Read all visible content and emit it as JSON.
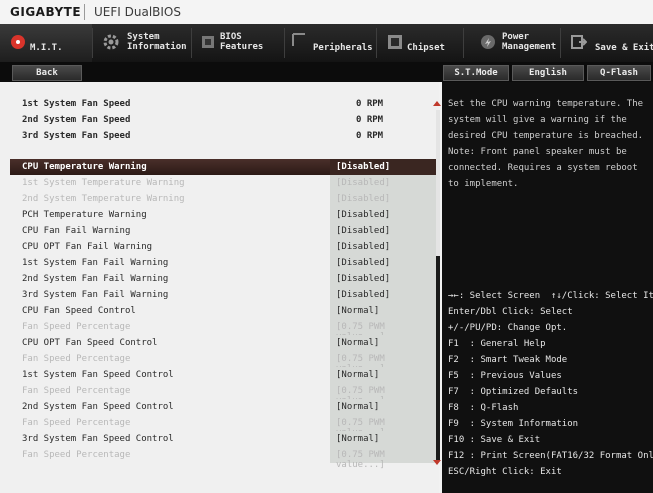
{
  "brand": {
    "logo_text": "GIGABYTE",
    "bios_name": "UEFI DualBIOS"
  },
  "tabs": [
    {
      "label": "M.I.T.",
      "icon": "mit-icon",
      "active": true
    },
    {
      "label": "System\nInformation",
      "icon": "gear-icon"
    },
    {
      "label": "BIOS\nFeatures",
      "icon": "bios-icon"
    },
    {
      "label": "Peripherals",
      "icon": "peripherals-icon"
    },
    {
      "label": "Chipset",
      "icon": "chipset-icon"
    },
    {
      "label": "Power\nManagement",
      "icon": "power-icon"
    },
    {
      "label": "Save & Exit",
      "icon": "exit-icon"
    }
  ],
  "subbar": {
    "back": "Back",
    "st_mode": "S.T.Mode",
    "language": "English",
    "qflash": "Q-Flash"
  },
  "fan_speeds": [
    {
      "label": "1st System Fan Speed",
      "value": "0 RPM"
    },
    {
      "label": "2nd System Fan Speed",
      "value": "0 RPM"
    },
    {
      "label": "3rd System Fan Speed",
      "value": "0 RPM"
    }
  ],
  "settings": [
    {
      "label": "CPU Temperature Warning",
      "value": "[Disabled]",
      "state": "sel"
    },
    {
      "label": "1st System Temperature Warning",
      "value": "[Disabled]",
      "state": "dim"
    },
    {
      "label": "2nd System Temperature Warning",
      "value": "[Disabled]",
      "state": "dim"
    },
    {
      "label": "PCH Temperature Warning",
      "value": "[Disabled]",
      "state": "dim"
    },
    {
      "label": "CPU Fan Fail Warning",
      "value": "[Disabled]",
      "state": "dim"
    },
    {
      "label": "CPU OPT Fan Fail Warning",
      "value": "[Disabled]",
      "state": "dim"
    },
    {
      "label": "1st System Fan Fail Warning",
      "value": "[Disabled]",
      "state": "dim"
    },
    {
      "label": "2nd System Fan Fail Warning",
      "value": "[Disabled]",
      "state": "dim"
    },
    {
      "label": "3rd System Fan Fail Warning",
      "value": "[Disabled]",
      "state": "dim"
    },
    {
      "label": "CPU Fan Speed Control",
      "value": "[Normal]",
      "state": "dim"
    },
    {
      "label": "Fan Speed Percentage",
      "value": "[0.75 PWM value...]",
      "state": "faint"
    },
    {
      "label": "CPU OPT Fan Speed Control",
      "value": "[Normal]",
      "state": "dim"
    },
    {
      "label": "Fan Speed Percentage",
      "value": "[0.75 PWM value...]",
      "state": "faint"
    },
    {
      "label": "1st System Fan Speed Control",
      "value": "[Normal]",
      "state": "dim"
    },
    {
      "label": "Fan Speed Percentage",
      "value": "[0.75 PWM value...]",
      "state": "faint"
    },
    {
      "label": "2nd System Fan Speed Control",
      "value": "[Normal]",
      "state": "dim"
    },
    {
      "label": "Fan Speed Percentage",
      "value": "[0.75 PWM value...]",
      "state": "faint"
    },
    {
      "label": "3rd System Fan Speed Control",
      "value": "[Normal]",
      "state": "dim"
    },
    {
      "label": "Fan Speed Percentage",
      "value": "[0.75 PWM value...]",
      "state": "faint"
    }
  ],
  "help": {
    "text": "Set the CPU warning temperature. The system will  give a warning if the desired CPU temperature is breached. Note: Front panel speaker must be connected. Requires a system reboot to implement."
  },
  "keys": [
    "→←: Select Screen  ↑↓/Click: Select Item",
    "Enter/Dbl Click: Select",
    "+/-/PU/PD: Change Opt.",
    "F1  : General Help",
    "F2  : Smart Tweak Mode",
    "F5  : Previous Values",
    "F7  : Optimized Defaults",
    "F8  : Q-Flash",
    "F9  : System Information",
    "F10 : Save & Exit",
    "F12 : Print Screen(FAT16/32 Format Only)",
    "ESC/Right Click: Exit"
  ],
  "colors": {
    "accent": "#c0392b",
    "selected_row": "#3a2621",
    "dark_bar": "#141414"
  }
}
